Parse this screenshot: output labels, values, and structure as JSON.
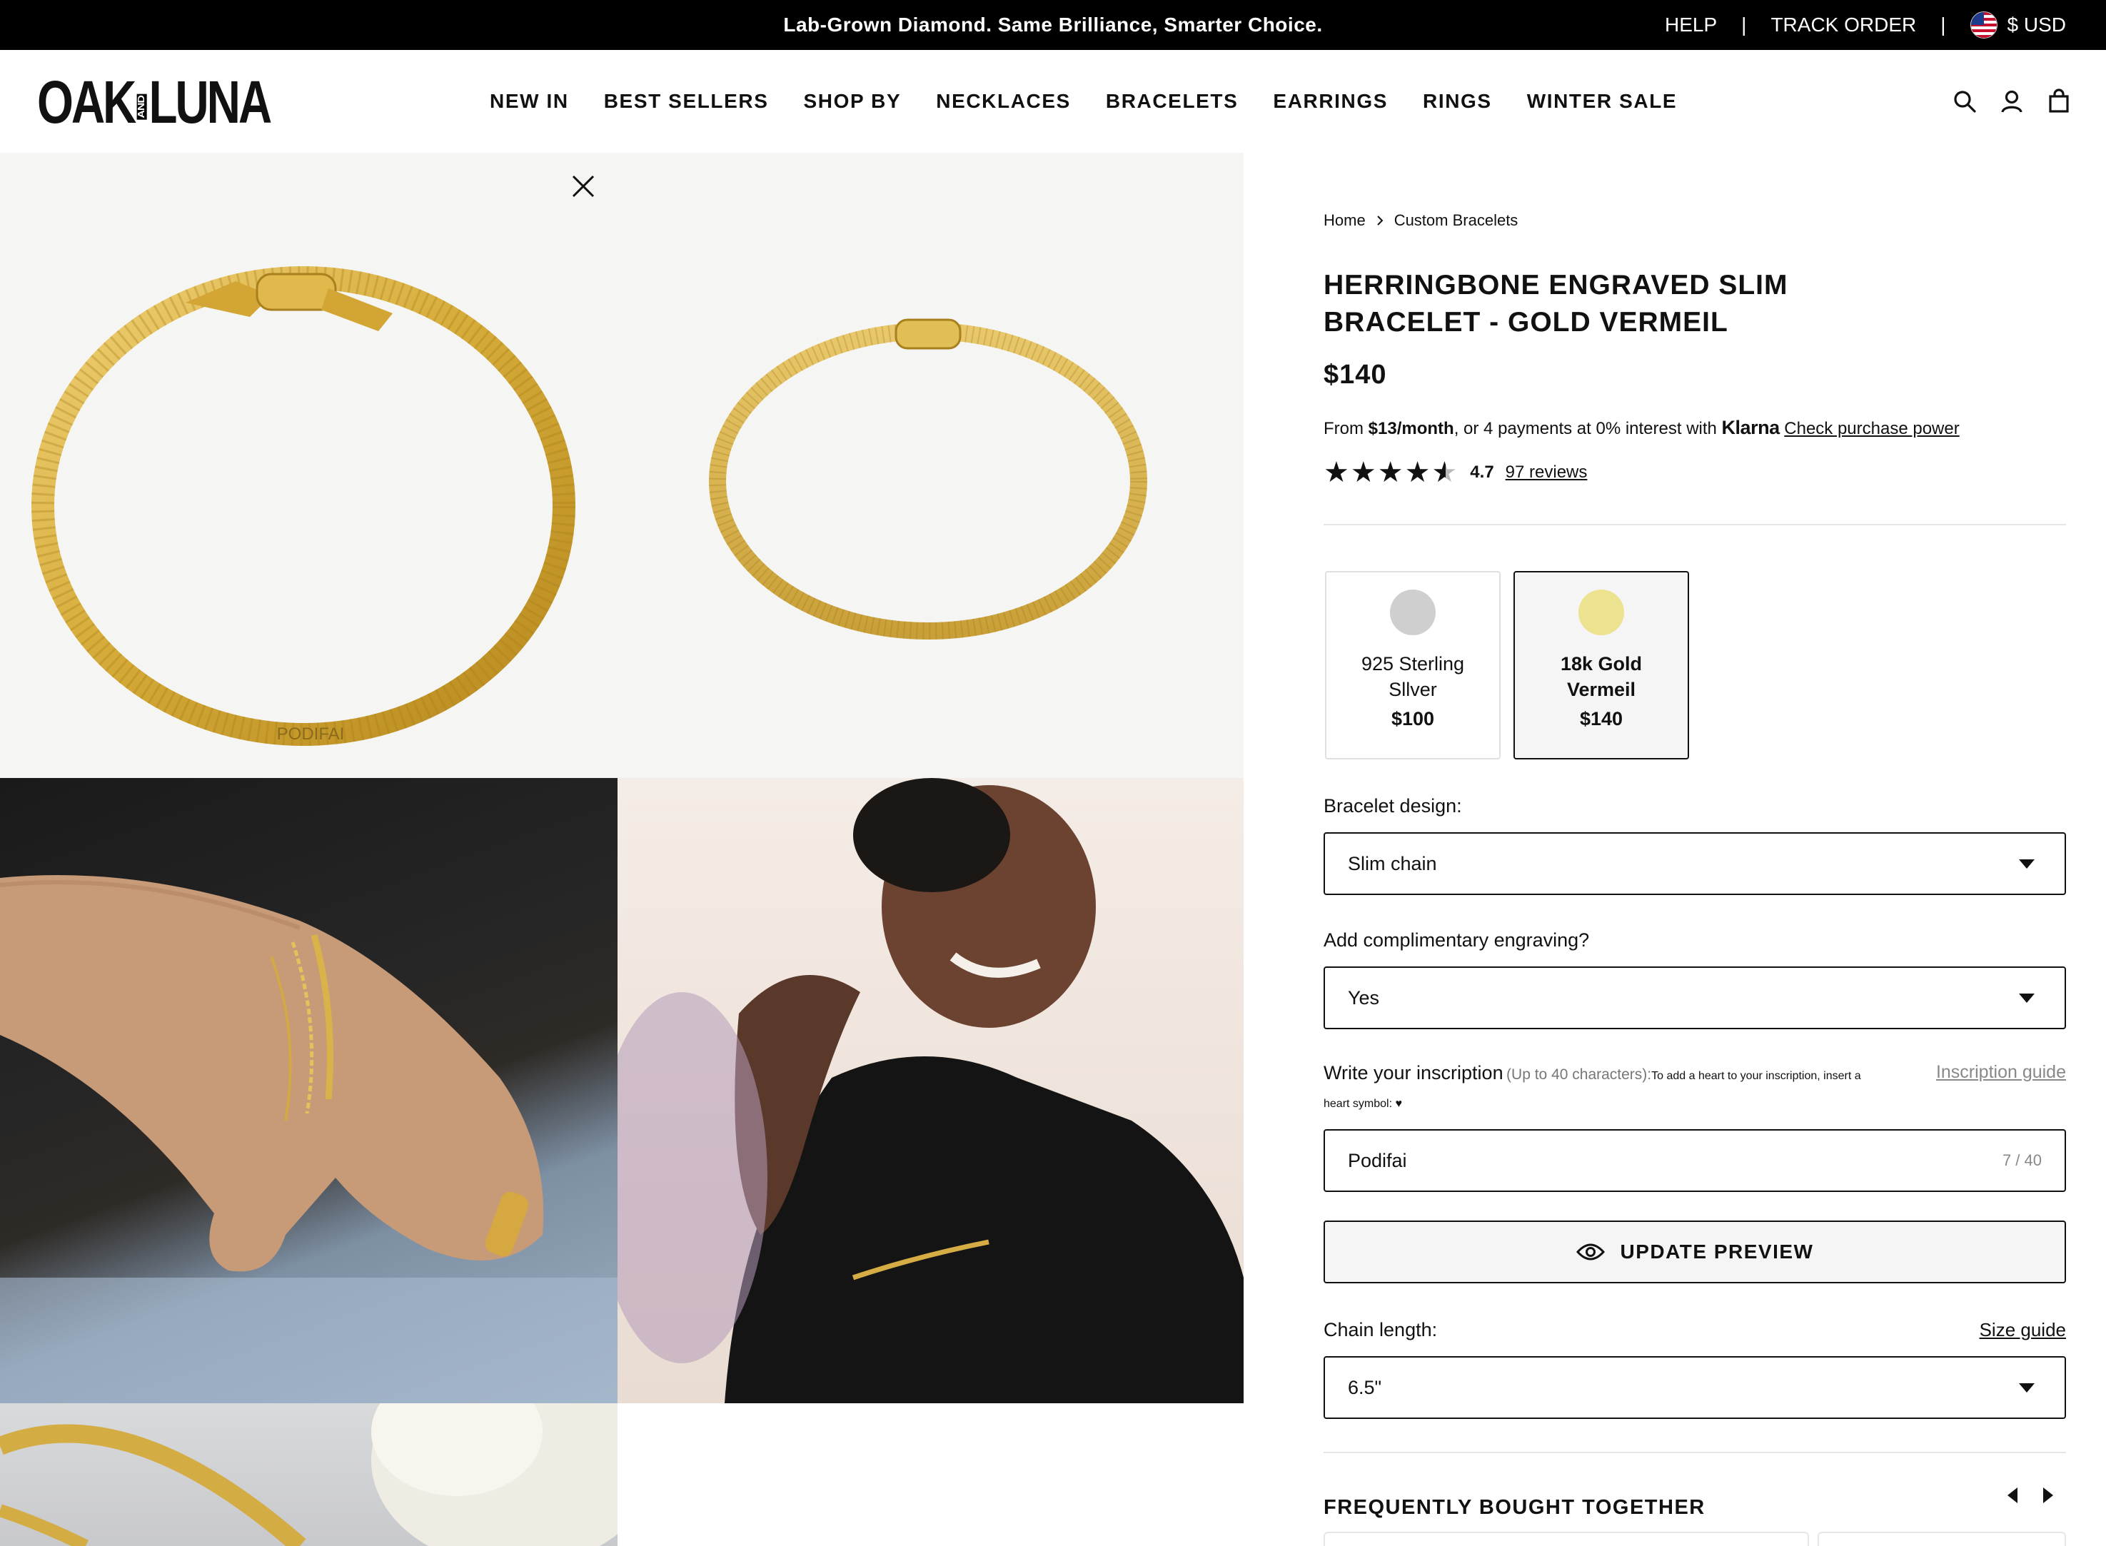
{
  "announcement": {
    "text": "Lab-Grown Diamond. Same Brilliance, Smarter Choice.",
    "help": "HELP",
    "separator": "|",
    "track_order": "TRACK ORDER",
    "currency": "$ USD"
  },
  "header": {
    "logo_left": "OAK",
    "logo_and": "AND",
    "logo_right": "LUNA",
    "nav": [
      {
        "label": "NEW IN"
      },
      {
        "label": "BEST SELLERS"
      },
      {
        "label": "SHOP BY"
      },
      {
        "label": "NECKLACES"
      },
      {
        "label": "BRACELETS"
      },
      {
        "label": "EARRINGS"
      },
      {
        "label": "RINGS"
      },
      {
        "label": "WINTER SALE"
      }
    ],
    "icons": [
      "search-icon",
      "account-icon",
      "bag-icon"
    ]
  },
  "gallery": {
    "engraving_preview": "PODIFAI",
    "close_icon": "close-icon"
  },
  "product": {
    "breadcrumb": {
      "home": "Home",
      "current": "Custom Bracelets"
    },
    "title": "HERRINGBONE ENGRAVED SLIM BRACELET - GOLD VERMEIL",
    "price": "$140",
    "klarna": {
      "prefix": "From ",
      "monthly": "$13/month",
      "middle": ", or 4 payments at 0% interest with ",
      "brand": "Klarna",
      "link": "Check purchase power"
    },
    "rating": {
      "value": "4.7",
      "stars": 4.7,
      "reviews": "97 reviews"
    },
    "metals": [
      {
        "name": "925 Sterling Sllver",
        "price": "$100",
        "color": "#cfcfcf",
        "selected": false
      },
      {
        "name": "18k Gold Vermeil",
        "price": "$140",
        "color": "#ece28f",
        "selected": true
      }
    ],
    "design": {
      "label": "Bracelet design:",
      "value": "Slim chain"
    },
    "engraving": {
      "label": "Add complimentary engraving?",
      "value": "Yes"
    },
    "inscription": {
      "label": "Write your inscription",
      "hint": "(Up to 40 characters):",
      "note": "To add a heart to your inscription, insert a",
      "note2": "heart symbol: ♥",
      "guide": "Inscription guide",
      "value": "Podifai",
      "count": "7 / 40"
    },
    "update_button": "UPDATE PREVIEW",
    "chain_length": {
      "label": "Chain length:",
      "size_guide": "Size guide",
      "value": "6.5\""
    },
    "frequently_bought": "FREQUENTLY BOUGHT TOGETHER"
  },
  "colors": {
    "gold": "#d9b33c",
    "selected_border": "#111111"
  }
}
